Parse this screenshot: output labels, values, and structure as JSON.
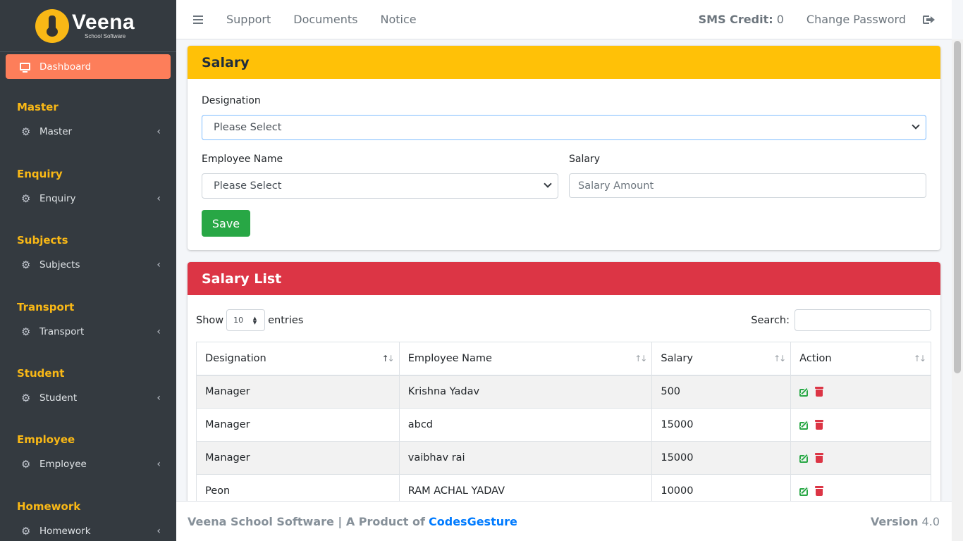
{
  "brand": {
    "name": "Veena",
    "subtitle": "School Software"
  },
  "sidebar": {
    "dashboard_label": "Dashboard",
    "sections": [
      {
        "header": "Master",
        "item": "Master"
      },
      {
        "header": "Enquiry",
        "item": "Enquiry"
      },
      {
        "header": "Subjects",
        "item": "Subjects"
      },
      {
        "header": "Transport",
        "item": "Transport"
      },
      {
        "header": "Student",
        "item": "Student"
      },
      {
        "header": "Employee",
        "item": "Employee"
      },
      {
        "header": "Homework",
        "item": "Homework"
      }
    ]
  },
  "topbar": {
    "links": [
      "Support",
      "Documents",
      "Notice"
    ],
    "sms_label": "SMS Credit:",
    "sms_value": "0",
    "change_password": "Change Password"
  },
  "salary_form": {
    "title": "Salary",
    "designation_label": "Designation",
    "designation_value": "Please Select",
    "employee_label": "Employee Name",
    "employee_value": "Please Select",
    "salary_label": "Salary",
    "salary_placeholder": "Salary Amount",
    "save_label": "Save"
  },
  "salary_list": {
    "title": "Salary List",
    "show_label": "Show",
    "entries_value": "10",
    "entries_label": "entries",
    "search_label": "Search:",
    "columns": [
      "Designation",
      "Employee Name",
      "Salary",
      "Action"
    ],
    "rows": [
      {
        "designation": "Manager",
        "employee": "Krishna Yadav",
        "salary": "500"
      },
      {
        "designation": "Manager",
        "employee": "abcd",
        "salary": "15000"
      },
      {
        "designation": "Manager",
        "employee": "vaibhav rai",
        "salary": "15000"
      },
      {
        "designation": "Peon",
        "employee": "RAM ACHAL YADAV",
        "salary": "10000"
      }
    ]
  },
  "footer": {
    "text": "Veena School Software | A Product of",
    "company": "CodesGesture",
    "version_label": "Version",
    "version_value": "4.0"
  },
  "colors": {
    "sidebar_bg": "#343a40",
    "accent_orange": "#fd7e5a",
    "section_yellow": "#f9b816",
    "salary_header": "#ffc107",
    "list_header": "#dc3545",
    "save_green": "#28a745",
    "link_blue": "#007bff"
  }
}
